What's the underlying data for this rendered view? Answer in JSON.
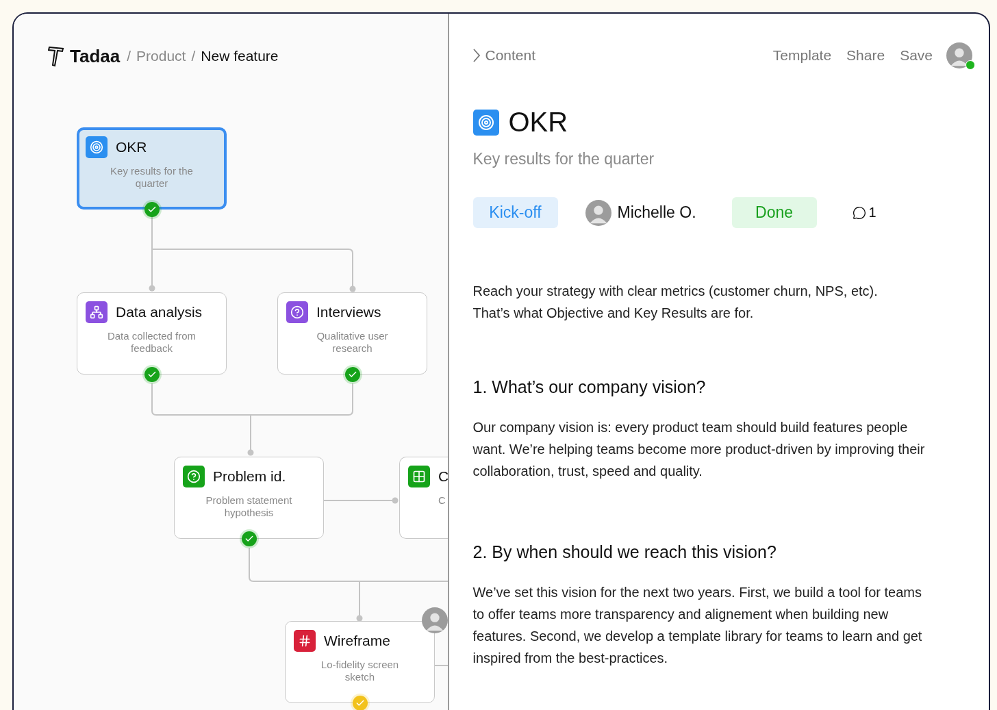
{
  "breadcrumb": {
    "brand": "Tadaa",
    "items": [
      {
        "kind": "separator",
        "text": "/"
      },
      {
        "kind": "link",
        "text": "Product"
      },
      {
        "kind": "separator",
        "text": "/"
      },
      {
        "kind": "current",
        "text": "New feature"
      }
    ]
  },
  "flow": {
    "nodes": [
      {
        "kind": "target",
        "title": "OKR",
        "description": "Key results for the quarter",
        "selected": true,
        "badge": {
          "color": "#16a31a"
        },
        "color": "#2b8ff0"
      },
      {
        "kind": "network",
        "title": "Data analysis",
        "description": "Data collected from feedback",
        "selected": false,
        "badge": {
          "color": "#16a31a"
        },
        "color": "#8b51e0"
      },
      {
        "kind": "question",
        "title": "Interviews",
        "description": "Qualitative user research",
        "selected": false,
        "badge": {
          "color": "#16a31a"
        },
        "color": "#8b51e0"
      },
      {
        "kind": "question",
        "title": "Problem id.",
        "description": "Problem statement hypothesis",
        "selected": false,
        "badge": {
          "color": "#16a31a"
        },
        "color": "#16a31a"
      },
      {
        "kind": "grid",
        "title": "C",
        "description": "C",
        "selected": false,
        "color": "#16a31a"
      },
      {
        "kind": "hash",
        "title": "Wireframe",
        "description": "Lo-fidelity screen sketch",
        "selected": false,
        "badge": {
          "color": "#f2c21b"
        },
        "color": "#d8213a",
        "has_collaborator": true
      }
    ]
  },
  "panel": {
    "toggle": "Content",
    "actions": [
      "Template",
      "Share",
      "Save"
    ],
    "user_online": true,
    "title": "OKR",
    "subtitle": "Key results for the quarter",
    "meta": {
      "stage": "Kick-off",
      "assignee": "Michelle O.",
      "status": "Done",
      "comments": "1"
    },
    "intro": "Reach your strategy with clear metrics (customer churn, NPS, etc).\nThat’s what Objective and Key Results are for.",
    "sections": [
      {
        "heading": "1. What’s our company vision?",
        "text": "Our company vision is: every product team should build features people want. We’re helping teams become more product-driven by improving their collaboration, trust, speed and quality."
      },
      {
        "heading": "2. By when should we reach this vision?",
        "text": "We’ve set this vision for the next two years. First, we build a tool for teams to offer teams more transparency and alignement when building new features. Second, we develop a template library for teams to learn and get inspired from the best-practices."
      }
    ]
  }
}
